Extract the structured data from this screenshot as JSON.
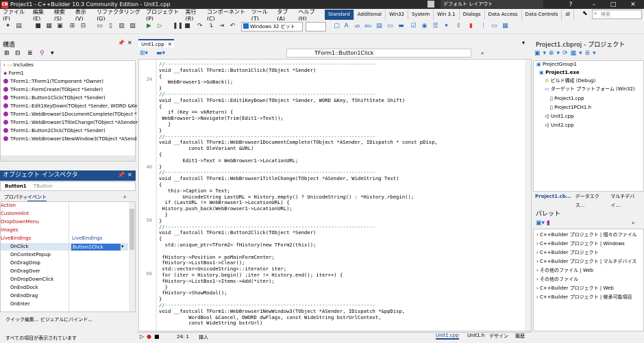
{
  "app": {
    "title": "Project1 - C++Builder 10.3 Community Edition - Unit1.cpp",
    "logo": "CB",
    "layout": "デフォルト レイアウト",
    "search_placeholder": "検索"
  },
  "menu": [
    "ファイル(F)",
    "編集(E)",
    "検索(S)",
    "表示(V)",
    "リファクタリング(G)",
    "プロジェクト(P)",
    "実行(R)",
    "コンポーネント(C)",
    "ツール(T)",
    "タブ(A)",
    "ヘルプ(H)"
  ],
  "palette_tabs": [
    "Standard",
    "Additional",
    "Win32",
    "System",
    "Win 3.1",
    "Dialogs",
    "Data Access",
    "Data Controls",
    "dl"
  ],
  "platform": "Windows 32 ビット",
  "structure": {
    "title": "構造",
    "items": [
      "Includes",
      "Form1",
      "TForm1::TForm1(TComponent *Owner)",
      "TForm1::FormCreate(TObject *Sender)",
      "TForm1::Button1Click(TObject *Sender)",
      "TForm1::Edit1KeyDown(TObject *Sender, WORD &Ke",
      "TForm1::WebBrowser1DocumentComplete(TObject *",
      "TForm1::WebBrowser1TitleChange(TObject *ASender",
      "TForm1::Button2Click(TObject *Sender)",
      "TForm1::WebBrowser1NewWindow3(TObject *ASend"
    ]
  },
  "inspector": {
    "title": "オブジェクト インスペクタ",
    "object": "Button1",
    "object_type": "TButton",
    "tab_props": "プロパティ",
    "tab_events": "イベント",
    "rows": [
      {
        "name": "Action",
        "value": ""
      },
      {
        "name": "CustomHint",
        "value": ""
      },
      {
        "name": "DropDownMenu",
        "value": ""
      },
      {
        "name": "Images",
        "value": ""
      },
      {
        "name": "LiveBindings",
        "value": "LiveBindings"
      },
      {
        "name": "OnClick",
        "value": "Button1Click"
      },
      {
        "name": "OnContextPopup",
        "value": ""
      },
      {
        "name": "OnDragDrop",
        "value": ""
      },
      {
        "name": "OnDragOver",
        "value": ""
      },
      {
        "name": "OnDropDownClick",
        "value": ""
      },
      {
        "name": "OnEndDock",
        "value": ""
      },
      {
        "name": "OnEndDrag",
        "value": ""
      },
      {
        "name": "OnEnter",
        "value": ""
      }
    ],
    "footer": "クイック編集... ビジュアルにバインド...",
    "status": "すべての項目が表示されています"
  },
  "editor": {
    "tab": "Unit1.cpp",
    "method": "TForm1::Button1Click",
    "line_numbers": [
      "24",
      "40",
      "50",
      "60"
    ],
    "status_pos": "24: 1",
    "status_mode": "挿入",
    "bottom_tabs": [
      "Unit1.cpp",
      "Unit1.h",
      "デザイン",
      "履歴"
    ]
  },
  "code": [
    "//-----------------------------------------------------------------------",
    "void __fastcall TForm1::Button1Click(TObject *Sender)",
    "{",
    "   WebBrowser1->GoBack();",
    "}",
    "//-----------------------------------------------------------------------",
    "void __fastcall TForm1::Edit1KeyDown(TObject *Sender, WORD &Key, TShiftState Shift)",
    "{",
    "   if (Key == vkReturn) {",
    " WebBrowser1->Navigate(Trim(Edit1->Text));",
    "   }",
    "}",
    "//-----------------------------------------------------------------------",
    "void __fastcall TForm1::WebBrowser1DocumentComplete(TObject *ASender, IDispatch * const pDisp,",
    "          const OleVariant &URL)",
    "{",
    "        Edit1->Text = WebBrowser1->LocationURL;",
    "}",
    "//-----------------------------------------------------------------------",
    "void __fastcall TForm1::WebBrowser1TitleChange(TObject *ASender, WideString Text)",
    "{",
    "   this->Caption = Text;",
    "        UnicodeString LastURL = History.empty() ? UnicodeString() : *History.rbegin();",
    "  if (LastURL != WebBrowser1->LocationURL) {",
    " History.push_back(WebBrowser1->LocationURL);",
    "  }",
    "}",
    "//-----------------------------------------------------------------------",
    "void __fastcall TForm1::Button2Click(TObject *Sender)",
    "{",
    "  std::unique_ptr<TForm2> fHistory(new TForm2(this));",
    "",
    " fHistory->Position = poMainFormCenter;",
    " fHistory->ListBox1->Clear();",
    " std::vector<UnicodeString>::iterator iter;",
    " for (iter = History.begin() ;iter != History.end(); iter++) {",
    " fHistory->ListBox1->Items->Add(*iter);",
    "  }",
    " fHistory->ShowModal();",
    "}",
    "//-----------------------------------------------------------------------",
    "void __fastcall TForm1::WebBrowser1NewWindow3(TObject *ASender, IDispatch *&ppDisp,",
    "          WordBool &Cancel, DWORD dwFlags, const WideString bstrUrlContext,",
    "          const WideString bstrUrl)"
  ],
  "project": {
    "title": "Project1.cbproj - プロジェクト",
    "items": [
      "ProjectGroup1",
      "Project1.exe",
      "ビルド構成 (Debug)",
      "ターゲット プラットフォーム (Win32)",
      "Project1.cpp",
      "Project1PCH1.h",
      "Unit1.cpp",
      "Unit2.cpp"
    ],
    "tabs": [
      "Project1.cb...",
      "データエクス...",
      "マルチデバイ..."
    ]
  },
  "palette": {
    "title": "パレット",
    "items": [
      "C++Builder プロジェクト | 個々のファイル",
      "C++Builder プロジェクト | Windows",
      "C++Builder プロジェクト",
      "C++Builder プロジェクト | マルチデバイス",
      "その他のファイル | Web",
      "その他のファイル",
      "C++Builder プロジェクト | Web",
      "C++Builder プロジェクト | 継承可能項目"
    ]
  }
}
